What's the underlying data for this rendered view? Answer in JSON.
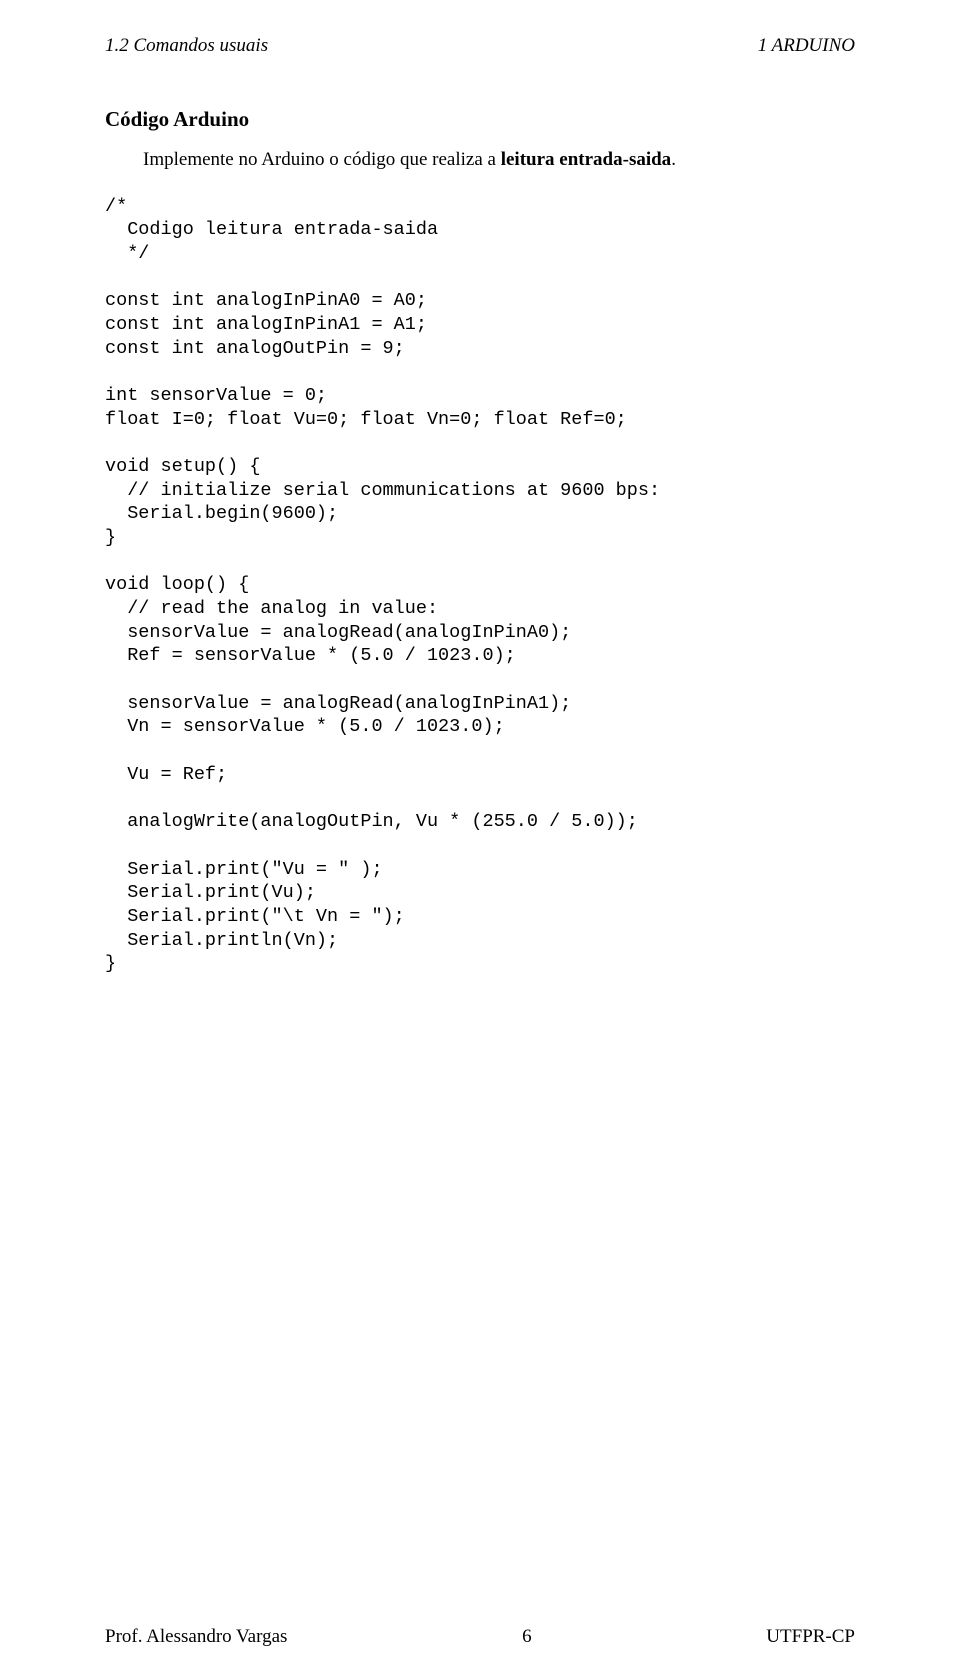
{
  "header": {
    "left": "1.2   Comandos usuais",
    "right": "1   ARDUINO"
  },
  "section_title": "Código Arduino",
  "intro": {
    "pre": "Implemente no Arduino o código que realiza a ",
    "bold": "leitura entrada-saida",
    "post": "."
  },
  "code": "/*\n  Codigo leitura entrada-saida\n  */\n\nconst int analogInPinA0 = A0;\nconst int analogInPinA1 = A1;\nconst int analogOutPin = 9;\n\nint sensorValue = 0;\nfloat I=0; float Vu=0; float Vn=0; float Ref=0;\n\nvoid setup() {\n  // initialize serial communications at 9600 bps:\n  Serial.begin(9600);\n}\n\nvoid loop() {\n  // read the analog in value:\n  sensorValue = analogRead(analogInPinA0);\n  Ref = sensorValue * (5.0 / 1023.0);\n\n  sensorValue = analogRead(analogInPinA1);\n  Vn = sensorValue * (5.0 / 1023.0);\n\n  Vu = Ref;\n\n  analogWrite(analogOutPin, Vu * (255.0 / 5.0));\n\n  Serial.print(\"Vu = \" );\n  Serial.print(Vu);\n  Serial.print(\"\\t Vn = \");\n  Serial.println(Vn);\n}",
  "footer": {
    "left": "Prof. Alessandro Vargas",
    "center": "6",
    "right": "UTFPR-CP"
  }
}
